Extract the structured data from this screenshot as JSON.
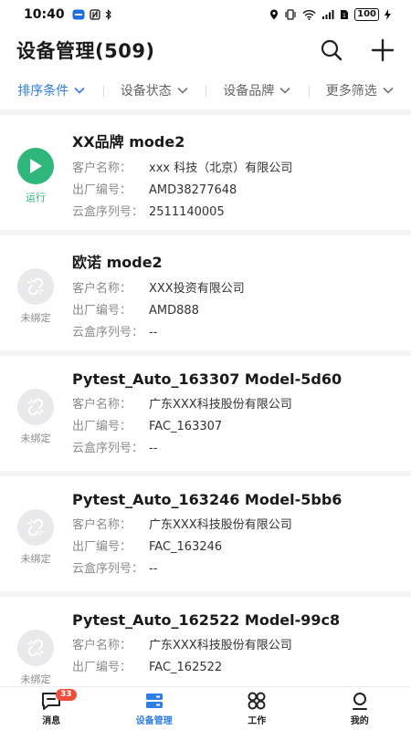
{
  "status_bar": {
    "time": "10:40",
    "battery": "100"
  },
  "header": {
    "title": "设备管理(509)"
  },
  "filters": [
    {
      "label": "排序条件"
    },
    {
      "label": "设备状态"
    },
    {
      "label": "设备品牌"
    },
    {
      "label": "更多筛选"
    }
  ],
  "field_labels": {
    "customer": "客户名称：",
    "factory_no": "出厂编号：",
    "cloud_sn": "云盒序列号："
  },
  "devices": [
    {
      "name": "XX品牌 mode2",
      "status": "运行",
      "customer": "xxx 科技（北京）有限公司",
      "factory_no": "AMD38277648",
      "cloud_sn": "2511140005"
    },
    {
      "name": "欧诺 mode2",
      "status": "未绑定",
      "customer": "XXX投资有限公司",
      "factory_no": "AMD888",
      "cloud_sn": "--"
    },
    {
      "name": "Pytest_Auto_163307 Model-5d60",
      "status": "未绑定",
      "customer": "广东XXX科技股份有限公司",
      "factory_no": "FAC_163307",
      "cloud_sn": "--"
    },
    {
      "name": "Pytest_Auto_163246 Model-5bb6",
      "status": "未绑定",
      "customer": "广东XXX科技股份有限公司",
      "factory_no": "FAC_163246",
      "cloud_sn": "--"
    },
    {
      "name": "Pytest_Auto_162522 Model-99c8",
      "status": "未绑定",
      "customer": "广东XXX科技股份有限公司",
      "factory_no": "FAC_162522",
      "cloud_sn": ""
    }
  ],
  "tabbar": {
    "messages": "消息",
    "messages_badge": "33",
    "devices": "设备管理",
    "work": "工作",
    "mine": "我的"
  },
  "colors": {
    "accent": "#2f7ee8",
    "running": "#2fb67a",
    "badge": "#f24c3d"
  }
}
